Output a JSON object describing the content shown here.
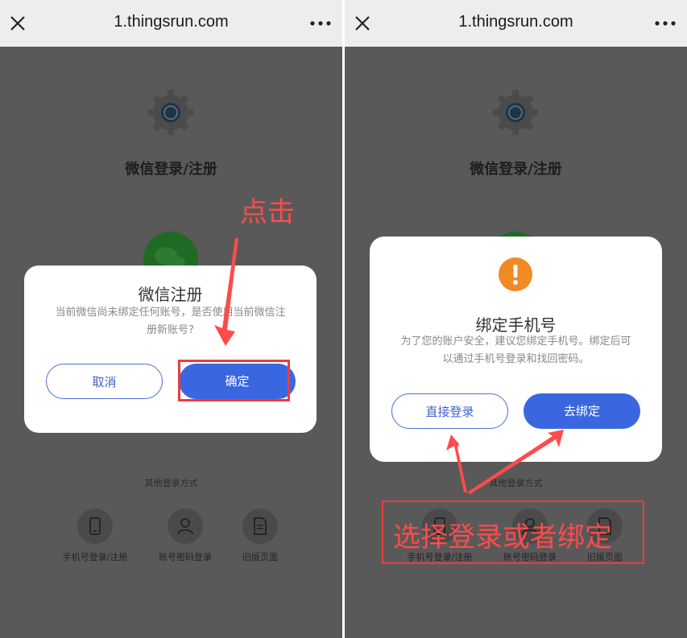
{
  "screens": [
    {
      "browser": {
        "url": "1.thingsrun.com"
      },
      "page": {
        "title": "微信登录/注册",
        "other_methods_label": "其他登录方式",
        "options": [
          {
            "label": "手机号登录/注册",
            "icon": "phone-icon"
          },
          {
            "label": "账号密码登录",
            "icon": "user-icon"
          },
          {
            "label": "旧版页面",
            "icon": "document-icon"
          }
        ]
      },
      "dialog": {
        "title": "微信注册",
        "message_line1": "当前微信尚未绑定任何账号，是否使用当前微信注",
        "message_line2": "册新账号?",
        "cancel_label": "取消",
        "confirm_label": "确定"
      },
      "annotation": {
        "text": "点击",
        "color": "#ff4b4b"
      }
    },
    {
      "browser": {
        "url": "1.thingsrun.com"
      },
      "page": {
        "title": "微信登录/注册",
        "other_methods_label": "其他登录方式",
        "options": [
          {
            "label": "手机号登录/注册",
            "icon": "phone-icon"
          },
          {
            "label": "账号密码登录",
            "icon": "user-icon"
          },
          {
            "label": "旧版页面",
            "icon": "document-icon"
          }
        ]
      },
      "dialog": {
        "icon": "exclamation-icon",
        "title": "绑定手机号",
        "message_line1": "为了您的账户安全，建议您绑定手机号。绑定后可",
        "message_line2": "以通过手机号登录和找回密码。",
        "direct_login_label": "直接登录",
        "bind_label": "去绑定"
      },
      "annotation": {
        "text": "选择登录或者绑定",
        "color": "#ff4b4b"
      }
    }
  ],
  "colors": {
    "primary": "#3a67e0",
    "warning": "#f08a24",
    "annotation": "#ff4b4b",
    "wechat": "#1f6b25"
  }
}
